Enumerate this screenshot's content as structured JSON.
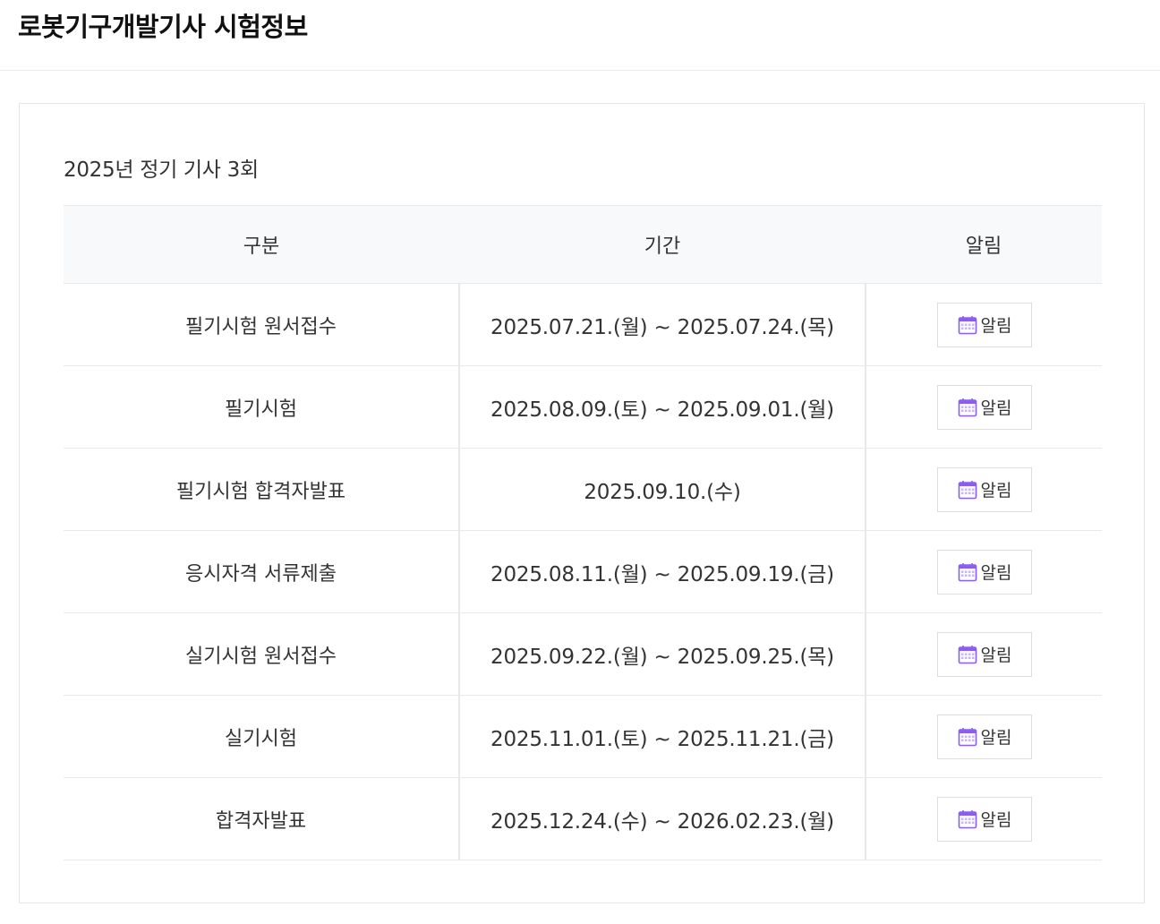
{
  "page": {
    "title": "로봇기구개발기사 시험정보"
  },
  "section": {
    "title": "2025년 정기 기사 3회"
  },
  "table": {
    "headers": [
      "구분",
      "기간",
      "알림"
    ],
    "rows": [
      {
        "category": "필기시험 원서접수",
        "period": "2025.07.21.(월) ~ 2025.07.24.(목)",
        "button": "알림"
      },
      {
        "category": "필기시험",
        "period": "2025.08.09.(토) ~ 2025.09.01.(월)",
        "button": "알림"
      },
      {
        "category": "필기시험 합격자발표",
        "period": "2025.09.10.(수)",
        "button": "알림"
      },
      {
        "category": "응시자격 서류제출",
        "period": "2025.08.11.(월) ~ 2025.09.19.(금)",
        "button": "알림"
      },
      {
        "category": "실기시험 원서접수",
        "period": "2025.09.22.(월) ~ 2025.09.25.(목)",
        "button": "알림"
      },
      {
        "category": "실기시험",
        "period": "2025.11.01.(토) ~ 2025.11.21.(금)",
        "button": "알림"
      },
      {
        "category": "합격자발표",
        "period": "2025.12.24.(수) ~ 2026.02.23.(월)",
        "button": "알림"
      }
    ]
  },
  "icons": {
    "alarm_button_icon": "calendar-icon"
  },
  "colors": {
    "accent": "#8b5cf6",
    "header_bg": "#f8f9fa",
    "border": "#e8e8e8"
  }
}
